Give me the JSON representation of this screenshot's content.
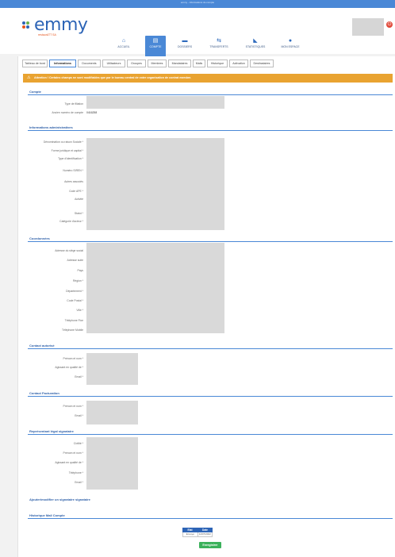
{
  "window": {
    "title": "emmy - Informations du compte"
  },
  "logo": {
    "word": "emmy",
    "tagline": "restaurATT SA"
  },
  "nav": [
    {
      "label": "ACCUEIL",
      "icon": "home-icon",
      "glyph": "⌂"
    },
    {
      "label": "COMPTE",
      "icon": "account-icon",
      "glyph": "▤",
      "active": true
    },
    {
      "label": "DOSSIERS",
      "icon": "folder-icon",
      "glyph": "▬"
    },
    {
      "label": "TRANSFERTS",
      "icon": "transfer-icon",
      "glyph": "⇆"
    },
    {
      "label": "STATISTIQUES",
      "icon": "chart-icon",
      "glyph": "◣"
    },
    {
      "label": "MON ESPACE",
      "icon": "user-icon",
      "glyph": "●"
    }
  ],
  "tabs": [
    {
      "label": "Tableau de bord"
    },
    {
      "label": "Informations",
      "active": true
    },
    {
      "label": "Documents"
    },
    {
      "label": "Utilisateurs"
    },
    {
      "label": "Groupes"
    },
    {
      "label": "Membres"
    },
    {
      "label": "Mandataires"
    },
    {
      "label": "Mails"
    },
    {
      "label": "Historique"
    },
    {
      "label": "Activation"
    },
    {
      "label": "Destinataires"
    }
  ],
  "warning": {
    "text": "Attention ! Certains champs ne sont modifiables que par le bureau central de votre organisation de contrat membre."
  },
  "sections": {
    "compte": {
      "title": "Compte",
      "fields": [
        {
          "label": "Type de filiation"
        },
        {
          "label": "Ancien numéro de compte",
          "value": "0416258"
        }
      ]
    },
    "admin": {
      "title": "Informations administratives",
      "fields": [
        {
          "label": "Dénomination ou raison Sociale *"
        },
        {
          "label": "Forme juridique et capital *"
        },
        {
          "label": "Type d'identification *"
        },
        {
          "label": "Numéro SIREN *"
        },
        {
          "label": "Autres associés"
        },
        {
          "label": "Code APE *"
        },
        {
          "label": "Activité"
        },
        {
          "label": "Statut *"
        },
        {
          "label": "Catégorie d'acteur *"
        }
      ]
    },
    "coord": {
      "title": "Coordonnées",
      "fields": [
        {
          "label": "Adresse du siège social"
        },
        {
          "label": "Adresse suite"
        },
        {
          "label": "Pays"
        },
        {
          "label": "Région *"
        },
        {
          "label": "Département *"
        },
        {
          "label": "Code Postal *"
        },
        {
          "label": "Ville *"
        },
        {
          "label": "Téléphone Fixe"
        },
        {
          "label": "Téléphone Mobile"
        }
      ]
    },
    "contact_auth": {
      "title": "Contact autorisé",
      "fields": [
        {
          "label": "Prénom et nom *"
        },
        {
          "label": "Agissant en qualité de *"
        },
        {
          "label": "Email *"
        }
      ]
    },
    "contact_fact": {
      "title": "Contact Facturation",
      "fields": [
        {
          "label": "Prénom et nom *"
        },
        {
          "label": "Email *"
        }
      ]
    },
    "rep_legal": {
      "title": "Représentant légal signataire",
      "fields": [
        {
          "label": "Civilité *"
        },
        {
          "label": "Prénom et nom *"
        },
        {
          "label": "Agissant en qualité de *"
        },
        {
          "label": "Téléphone *"
        },
        {
          "label": "Email *"
        }
      ]
    }
  },
  "add_signatory_link": "Ajouter/modifier un signataire signataire",
  "mail_history": {
    "title": "Historique Mail Compte",
    "headers": [
      "Etat",
      "Date"
    ],
    "row": [
      "Envoyé",
      "14/07/2022"
    ]
  },
  "save_button": "Enregistrer",
  "colors": {
    "brand": "#4a88d6",
    "warning": "#e9a331",
    "save": "#3bb15b"
  }
}
